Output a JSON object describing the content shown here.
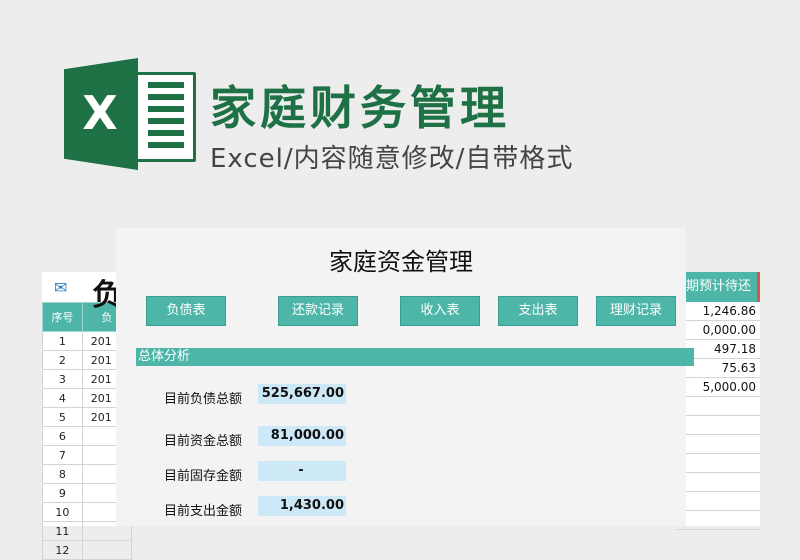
{
  "banner": {
    "logo_letter": "X",
    "title": "家庭财务管理",
    "subtitle": "Excel/内容随意修改/自带格式"
  },
  "left_sheet": {
    "title_partial": "负",
    "col_index": "序号",
    "col2": "负",
    "rows": [
      {
        "n": "1",
        "v": "201"
      },
      {
        "n": "2",
        "v": "201"
      },
      {
        "n": "3",
        "v": "201"
      },
      {
        "n": "4",
        "v": "201"
      },
      {
        "n": "5",
        "v": "201"
      },
      {
        "n": "6",
        "v": ""
      },
      {
        "n": "7",
        "v": ""
      },
      {
        "n": "8",
        "v": ""
      },
      {
        "n": "9",
        "v": ""
      },
      {
        "n": "10",
        "v": ""
      },
      {
        "n": "11",
        "v": ""
      },
      {
        "n": "12",
        "v": ""
      }
    ]
  },
  "right_sheet": {
    "header": "期预计待还",
    "values": [
      "1,246.86",
      "0,000.00",
      "497.18",
      "75.63",
      "5,000.00",
      "",
      "",
      "",
      "",
      "",
      "",
      ""
    ]
  },
  "panel": {
    "title": "家庭资金管理",
    "buttons": [
      "负债表",
      "还款记录",
      "收入表",
      "支出表",
      "理财记录"
    ],
    "section": "总体分析",
    "stats": [
      {
        "label": "目前负债总额",
        "value": "525,667.00"
      },
      {
        "label": "目前资金总额",
        "value": "81,000.00"
      },
      {
        "label": "目前固存金额",
        "value": "-"
      },
      {
        "label": "目前支出金额",
        "value": "1,430.00"
      }
    ]
  },
  "colors": {
    "brand_green": "#1e7145",
    "accent_teal": "#4db6a8",
    "value_bg": "#cde8f7"
  }
}
